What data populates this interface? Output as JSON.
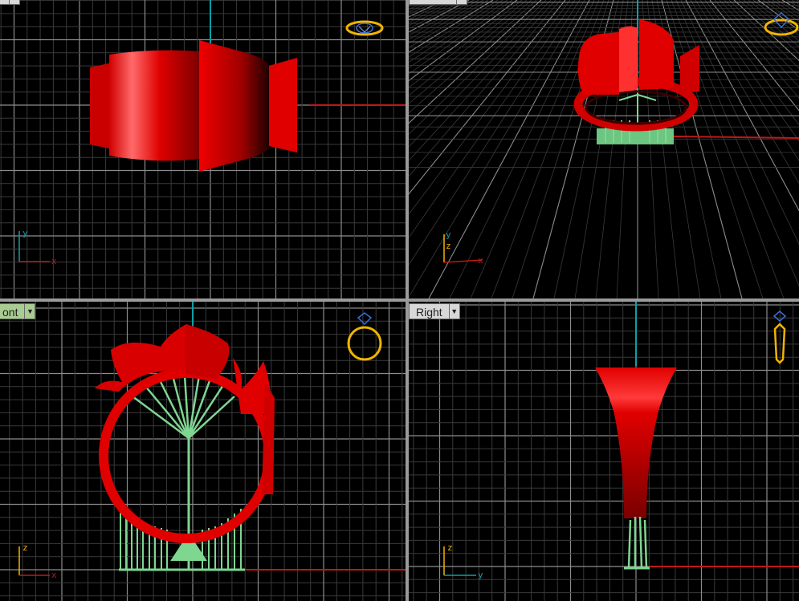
{
  "viewports": {
    "top": {
      "title": "",
      "axes": {
        "horizontal": "x",
        "vertical": "y"
      }
    },
    "perspective": {
      "title": "",
      "axes": {
        "horizontal": "x",
        "vertical": "z",
        "depth": "y"
      }
    },
    "front": {
      "title": "ont",
      "axes": {
        "horizontal": "x",
        "vertical": "z"
      }
    },
    "right": {
      "title": "Right",
      "axes": {
        "horizontal": "y",
        "vertical": "z"
      }
    }
  },
  "icons": {
    "view_widget": "ring-view-widget-icon",
    "dropdown": "chevron-down-icon"
  },
  "colors": {
    "background": "#000000",
    "grid_minor": "#3a3a3a",
    "grid_major": "#8c8c8c",
    "x_axis": "#c01818",
    "y_axis": "#0aa0a8",
    "model_red": "#e00000",
    "support_green": "#7ed691",
    "active_tab": "#a9cc93",
    "inactive_tab": "#d8d8d8",
    "widget_gold": "#f0b400"
  }
}
